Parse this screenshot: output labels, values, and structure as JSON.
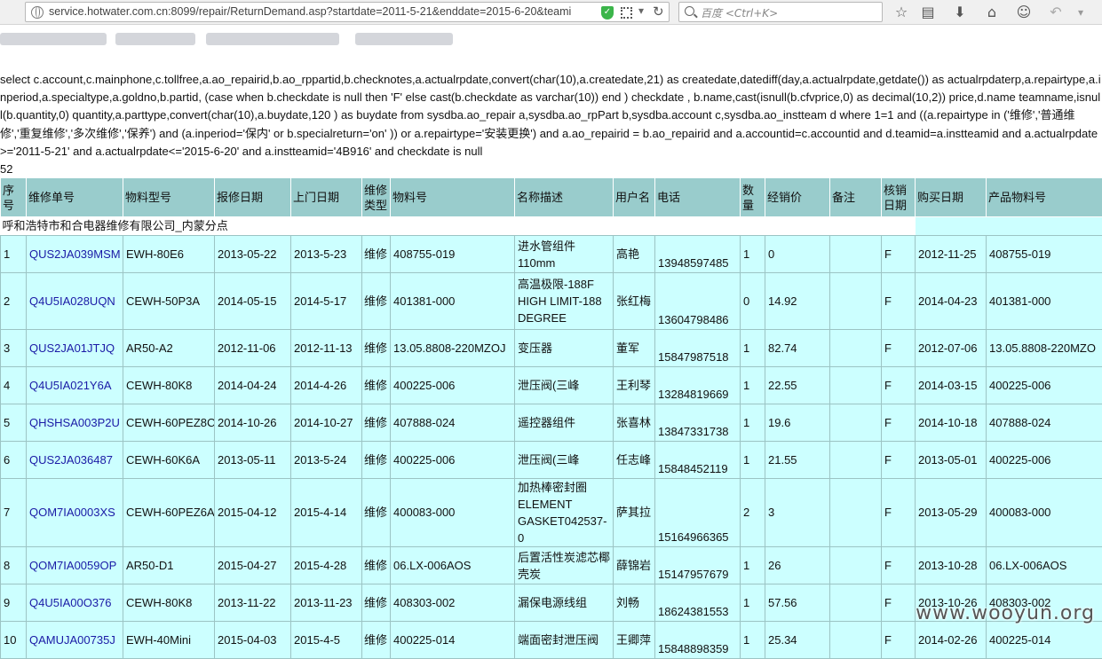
{
  "browser": {
    "url": "service.hotwater.com.cn:8099/repair/ReturnDemand.asp?startdate=2011-5-21&enddate=2015-6-20&teami",
    "search_placeholder": "百度 <Ctrl+K>"
  },
  "sql": "select c.account,c.mainphone,c.tollfree,a.ao_repairid,b.ao_rppartid,b.checknotes,a.actualrpdate,convert(char(10),a.createdate,21) as createdate,datediff(day,a.actualrpdate,getdate()) as actualrpdaterp,a.repairtype,a.inperiod,a.specialtype,a.goldno,b.partid, (case when b.checkdate is null then 'F' else cast(b.checkdate as varchar(10)) end ) checkdate , b.name,cast(isnull(b.cfvprice,0) as decimal(10,2)) price,d.name teamname,isnull(b.quantity,0) quantity,a.parttype,convert(char(10),a.buydate,120 ) as buydate from sysdba.ao_repair a,sysdba.ao_rpPart b,sysdba.account c,sysdba.ao_instteam d where 1=1 and ((a.repairtype in ('维修','普通维修','重复维修','多次维修','保养') and (a.inperiod='保内' or b.specialreturn='on' )) or a.repairtype='安装更换') and a.ao_repairid = b.ao_repairid and a.accountid=c.accountid and d.teamid=a.instteamid and a.actualrpdate>='2011-5-21' and a.actualrpdate<='2015-6-20' and a.instteamid='4B916' and checkdate is null\n52",
  "table": {
    "headers": [
      "序号",
      "维修单号",
      "物料型号",
      "报修日期",
      "上门日期",
      "维修类型",
      "物料号",
      "名称描述",
      "用户名",
      "电话",
      "数量",
      "经销价",
      "备注",
      "核销日期",
      "购买日期",
      "产品物料号"
    ],
    "group_label": "呼和浩特市和合电器维修有限公司_内蒙分点",
    "rows": [
      {
        "no": "1",
        "order": "QUS2JA039MSM",
        "model": "EWH-80E6",
        "report": "2013-05-22",
        "visit": "2013-5-23",
        "type": "维修",
        "part": "408755-019",
        "desc": "进水管组件 110mm",
        "user": "高艳",
        "phone": "13948597485",
        "qty": "1",
        "price": "0",
        "note": "",
        "check": "F",
        "buy": "2012-11-25",
        "prod": "408755-019"
      },
      {
        "no": "2",
        "order": "Q4U5IA028UQN",
        "model": "CEWH-50P3A",
        "report": "2014-05-15",
        "visit": "2014-5-17",
        "type": "维修",
        "part": "401381-000",
        "desc": "高温极限-188F HIGH LIMIT-188 DEGREE",
        "user": "张红梅",
        "phone": "13604798486",
        "qty": "0",
        "price": "14.92",
        "note": "",
        "check": "F",
        "buy": "2014-04-23",
        "prod": "401381-000"
      },
      {
        "no": "3",
        "order": "QUS2JA01JTJQ",
        "model": "AR50-A2",
        "report": "2012-11-06",
        "visit": "2012-11-13",
        "type": "维修",
        "part": "13.05.8808-220MZOJ",
        "desc": "变压器",
        "user": "董军",
        "phone": "15847987518",
        "qty": "1",
        "price": "82.74",
        "note": "",
        "check": "F",
        "buy": "2012-07-06",
        "prod": "13.05.8808-220MZO"
      },
      {
        "no": "4",
        "order": "Q4U5IA021Y6A",
        "model": "CEWH-80K8",
        "report": "2014-04-24",
        "visit": "2014-4-26",
        "type": "维修",
        "part": "400225-006",
        "desc": "泄压阀(三峰",
        "user": "王利琴",
        "phone": "13284819669",
        "qty": "1",
        "price": "22.55",
        "note": "",
        "check": "F",
        "buy": "2014-03-15",
        "prod": "400225-006"
      },
      {
        "no": "5",
        "order": "QHSHSA003P2U",
        "model": "CEWH-60PEZ8C",
        "report": "2014-10-26",
        "visit": "2014-10-27",
        "type": "维修",
        "part": "407888-024",
        "desc": "遥控器组件",
        "user": "张喜林",
        "phone": "13847331738",
        "qty": "1",
        "price": "19.6",
        "note": "",
        "check": "F",
        "buy": "2014-10-18",
        "prod": "407888-024"
      },
      {
        "no": "6",
        "order": "QUS2JA036487",
        "model": "CEWH-60K6A",
        "report": "2013-05-11",
        "visit": "2013-5-24",
        "type": "维修",
        "part": "400225-006",
        "desc": "泄压阀(三峰",
        "user": "任志峰",
        "phone": "15848452119",
        "qty": "1",
        "price": "21.55",
        "note": "",
        "check": "F",
        "buy": "2013-05-01",
        "prod": "400225-006"
      },
      {
        "no": "7",
        "order": "QOM7IA0003XS",
        "model": "CEWH-60PEZ6A",
        "report": "2015-04-12",
        "visit": "2015-4-14",
        "type": "维修",
        "part": "400083-000",
        "desc": "加热棒密封圈 ELEMENT GASKET042537-0",
        "user": "萨其拉",
        "phone": "15164966365",
        "qty": "2",
        "price": "3",
        "note": "",
        "check": "F",
        "buy": "2013-05-29",
        "prod": "400083-000"
      },
      {
        "no": "8",
        "order": "QOM7IA0059OP",
        "model": "AR50-D1",
        "report": "2015-04-27",
        "visit": "2015-4-28",
        "type": "维修",
        "part": "06.LX-006AOS",
        "desc": "后置活性炭滤芯椰壳炭",
        "user": "薛锦岩",
        "phone": "15147957679",
        "qty": "1",
        "price": "26",
        "note": "",
        "check": "F",
        "buy": "2013-10-28",
        "prod": "06.LX-006AOS"
      },
      {
        "no": "9",
        "order": "Q4U5IA00O376",
        "model": "CEWH-80K8",
        "report": "2013-11-22",
        "visit": "2013-11-23",
        "type": "维修",
        "part": "408303-002",
        "desc": "漏保电源线组",
        "user": "刘畅",
        "phone": "18624381553",
        "qty": "1",
        "price": "57.56",
        "note": "",
        "check": "F",
        "buy": "2013-10-26",
        "prod": "408303-002"
      },
      {
        "no": "10",
        "order": "QAMUJA00735J",
        "model": "EWH-40Mini",
        "report": "2015-04-03",
        "visit": "2015-4-5",
        "type": "维修",
        "part": "400225-014",
        "desc": "端面密封泄压阀",
        "user": "王卿萍",
        "phone": "15848898359",
        "qty": "1",
        "price": "25.34",
        "note": "",
        "check": "F",
        "buy": "2014-02-26",
        "prod": "400225-014"
      }
    ]
  },
  "watermark": "www.wooyun.org"
}
